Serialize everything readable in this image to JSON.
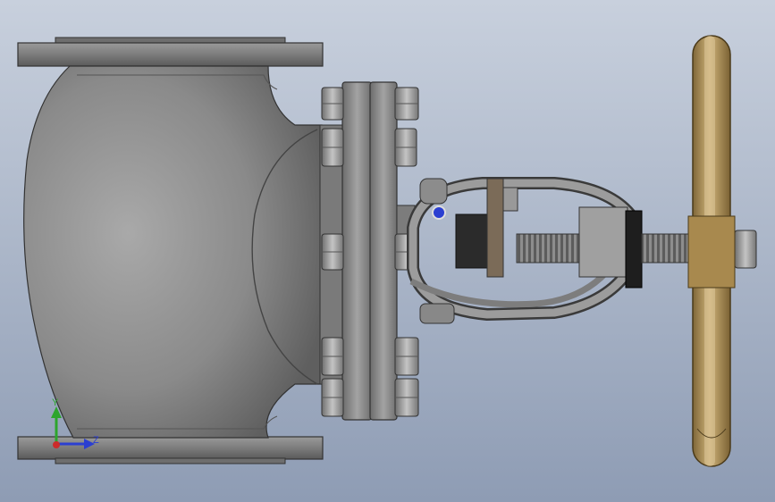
{
  "viewport": {
    "background_top": "#c6cedc",
    "background_bottom": "#8f9db5"
  },
  "model": {
    "body_color": "#7d7d7d",
    "flange_color": "#8a8a8a",
    "bolt_color": "#9b9b9b",
    "stem_color": "#5a5a5a",
    "handwheel_color": "#b0935a",
    "handwheel_dark": "#7a6133"
  },
  "triad": {
    "y_label": "Y",
    "z_label": "Z",
    "y_color": "#2da52d",
    "z_color": "#2b3fd1",
    "x_color": "#cc2b2b"
  }
}
